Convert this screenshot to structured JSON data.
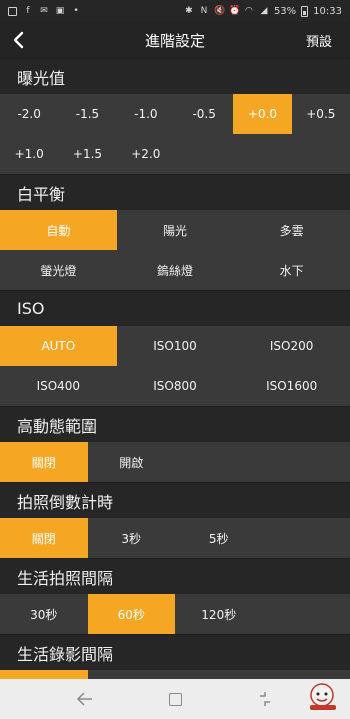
{
  "status_bar": {
    "battery": "53%",
    "time": "10:33"
  },
  "header": {
    "title": "進階設定",
    "preset_label": "預設"
  },
  "exposure": {
    "title": "曝光值",
    "options": [
      "-2.0",
      "-1.5",
      "-1.0",
      "-0.5",
      "+0.0",
      "+0.5",
      "+1.0",
      "+1.5",
      "+2.0"
    ],
    "selected": "+0.0"
  },
  "white_balance": {
    "title": "白平衡",
    "options": [
      "自動",
      "陽光",
      "多雲",
      "螢光燈",
      "鎢絲燈",
      "水下"
    ],
    "selected": "自動"
  },
  "iso": {
    "title": "ISO",
    "options": [
      "AUTO",
      "ISO100",
      "ISO200",
      "ISO400",
      "ISO800",
      "ISO1600"
    ],
    "selected": "AUTO"
  },
  "hdr": {
    "title": "高動態範圍",
    "options": [
      "關閉",
      "開啟"
    ],
    "selected": "關閉"
  },
  "timer": {
    "title": "拍照倒數計時",
    "options": [
      "關閉",
      "3秒",
      "5秒"
    ],
    "selected": "關閉"
  },
  "photo_interval": {
    "title": "生活拍照間隔",
    "options": [
      "30秒",
      "60秒",
      "120秒"
    ],
    "selected": "60秒"
  },
  "video_interval": {
    "title": "生活錄影間隔"
  },
  "colors": {
    "accent": "#f5a623",
    "background": "#2b2b2b",
    "option_bg": "#3a3a3a"
  },
  "icons": [
    "back-arrow-icon",
    "nav-back-icon",
    "nav-home-icon",
    "nav-recents-icon"
  ]
}
